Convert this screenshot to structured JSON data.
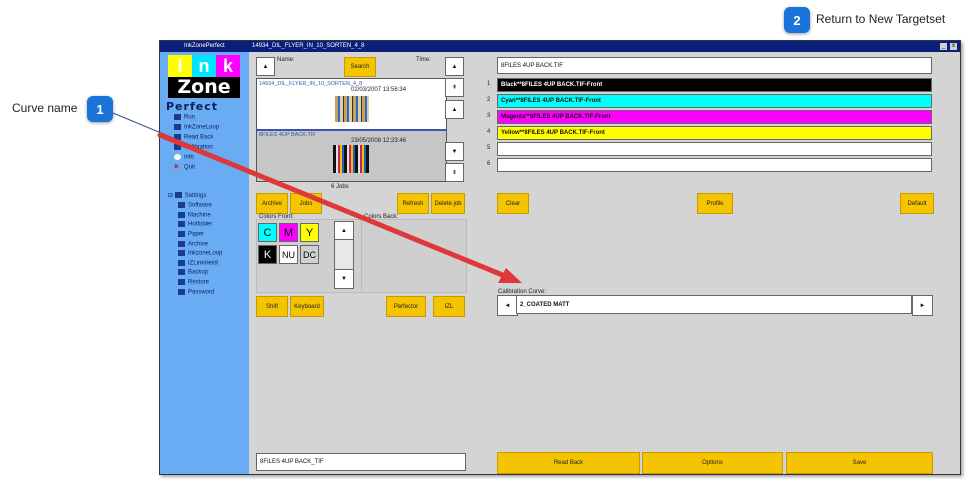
{
  "callouts": [
    {
      "number": "1",
      "label": "Curve name"
    },
    {
      "number": "2",
      "label": "Return to New Targetset"
    }
  ],
  "window": {
    "app_title": "InkZonePerfect",
    "doc_title": "14934_DIL_FLYER_IN_10_SORTEN_4_8",
    "min_btn": "_",
    "close_btn": "x"
  },
  "logo": {
    "letters": [
      "I",
      "n",
      "k"
    ],
    "word2": "Zone",
    "word3": "Perfect"
  },
  "sidebar": {
    "items": [
      "Run",
      "InkZoneLoop",
      "Read Back",
      "Calibration",
      "Info",
      "Quit"
    ],
    "settings_label": "Settings",
    "settings_items": [
      "Software",
      "Machine",
      "Hotfolder",
      "Paper",
      "Archive",
      "InkzoneLoop",
      "IZLinkHeidi",
      "Backup",
      "Restore",
      "Password"
    ]
  },
  "jobs": {
    "name_label": "Name:",
    "time_label": "Time:",
    "search_btn": "Search",
    "up_arrow": "▲",
    "down_arrow": "▼",
    "top_arrow": "⇞",
    "bottom_arrow": "⇟",
    "list": [
      {
        "name": "14934_DIL_FLYER_IN_10_SORTEN_4_8",
        "time": "02/03/2007 13:56:34"
      },
      {
        "name": "8FILES 4UP BACK.TIF",
        "time": "23/05/2008 12:23:46"
      }
    ],
    "count": "6 Jobs",
    "archive_btn": "Archive",
    "jobs_btn": "Jobs",
    "refresh_btn": "Refresh",
    "delete_btn": "Delete job"
  },
  "colors": {
    "front_label": "Colors Front:",
    "back_label": "Colors Back:",
    "buttons": [
      {
        "label": "C",
        "bg": "#00ffff"
      },
      {
        "label": "M",
        "bg": "#ff00ff"
      },
      {
        "label": "Y",
        "bg": "#ffff00"
      },
      {
        "label": "K",
        "bg": "#000000"
      },
      {
        "label": "NU",
        "bg": "#ffffff"
      },
      {
        "label": "DC",
        "bg": "#d0d0d0"
      }
    ]
  },
  "bottom_left": {
    "shift_btn": "Shift",
    "keyboard_btn": "Keyboard",
    "perfector_btn": "Perfector",
    "izl_btn": "IZL",
    "job_name": "8FILES 4UP BACK_TIF"
  },
  "right": {
    "header": "8FILES 4UP BACK.TIF",
    "separations": [
      {
        "num": "1",
        "label": "Black**8FILES 4UP BACK.TIF-Front",
        "bg": "#000000",
        "fg": "#ffffff"
      },
      {
        "num": "2",
        "label": "Cyan**8FILES 4UP BACK.TIF-Front",
        "bg": "#00ffff",
        "fg": "#000000"
      },
      {
        "num": "3",
        "label": "Magenta**8FILES 4UP BACK.TIF-Front",
        "bg": "#ff00ff",
        "fg": "#000000"
      },
      {
        "num": "4",
        "label": "Yellow**8FILES 4UP BACK.TIF-Front",
        "bg": "#ffff00",
        "fg": "#000000"
      },
      {
        "num": "5",
        "label": "",
        "bg": "#ffffff",
        "fg": "#000000"
      },
      {
        "num": "6",
        "label": "",
        "bg": "#ffffff",
        "fg": "#000000"
      }
    ],
    "clear_btn": "Clear",
    "profile_btn": "Profile",
    "default_btn": "Default",
    "calibration_label": "Calibration Curve:",
    "curve_name": "2_COATED MATT",
    "prev_arrow": "◄",
    "next_arrow": "►",
    "readback_btn": "Read Back",
    "options_btn": "Options",
    "save_btn": "Save"
  }
}
